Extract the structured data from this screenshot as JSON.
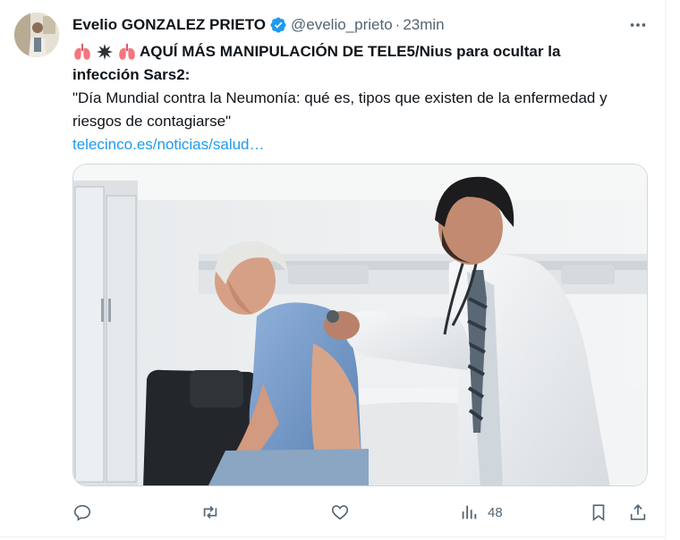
{
  "tweet": {
    "author_name": "Evelio GONZALEZ PRIETO",
    "handle": "@evelio_prieto",
    "separator": "·",
    "time": "23min",
    "headline": "AQUÍ MÁS MANIPULACIÓN DE TELE5/Nius para ocultar la",
    "headline_cont": "infección Sars2:",
    "quote": "\"Día Mundial contra la Neumonía: qué es, tipos que existen de la enfermedad y riesgos de contagiarse\"",
    "link": "telecinco.es/noticias/salud…",
    "emoji_icons": [
      "lungs-icon",
      "eight-pointed-star-icon",
      "lungs-icon"
    ]
  },
  "actions": {
    "reply_icon": "reply-icon",
    "retweet_icon": "retweet-icon",
    "like_icon": "heart-icon",
    "views_icon": "views-icon",
    "views_count": "48",
    "bookmark_icon": "bookmark-icon",
    "share_icon": "share-icon"
  },
  "colors": {
    "link": "#1d9bf0",
    "verified": "#1d9bf0",
    "muted": "#536471",
    "lungs": "#f4767f"
  }
}
